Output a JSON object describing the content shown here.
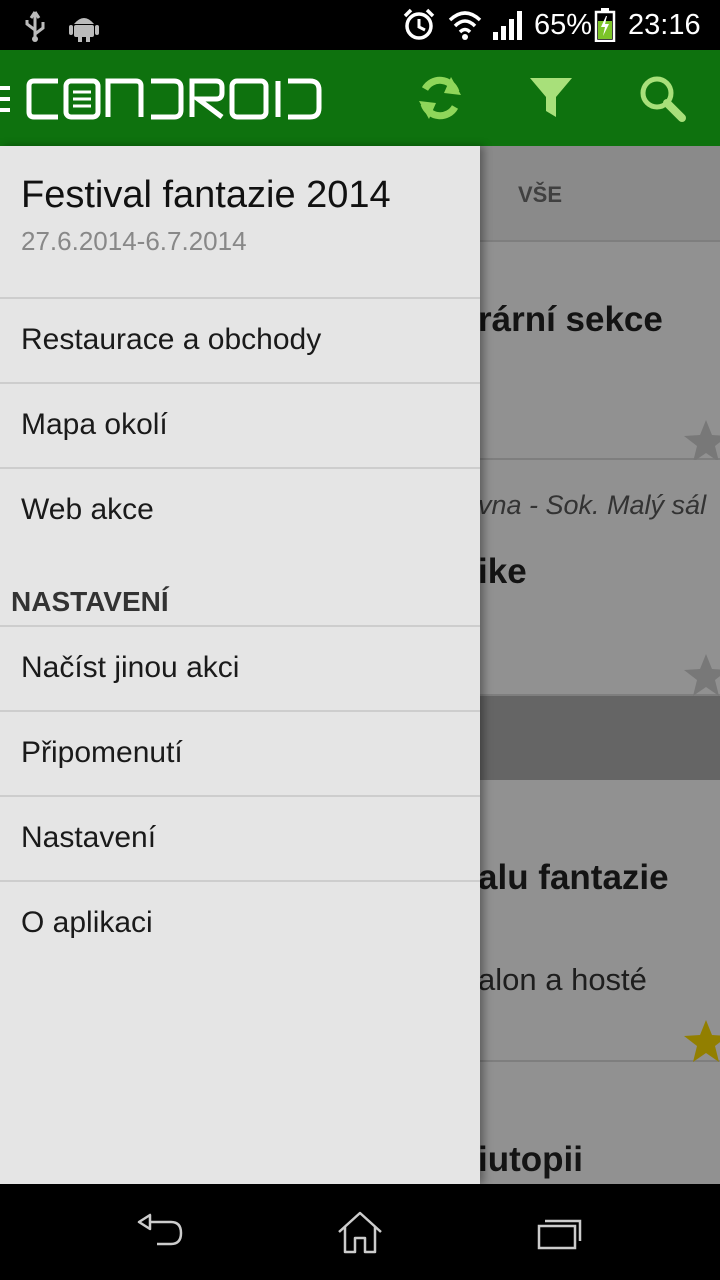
{
  "status_bar": {
    "battery_percent": "65%",
    "time": "23:16",
    "icons": [
      "usb-icon",
      "android-debug-icon",
      "alarm-icon",
      "wifi-icon",
      "signal-icon",
      "battery-charging-icon"
    ]
  },
  "app_bar": {
    "logo_text": "CONDROID",
    "actions": [
      "refresh",
      "filter",
      "search"
    ],
    "color": "#0e720e"
  },
  "background": {
    "tab_label": "VŠE",
    "cards": [
      {
        "title": "rární sekce"
      },
      {
        "subtitle": "vna - Sok. Malý sál",
        "title": "ike"
      },
      {
        "title": "alu fantazie",
        "text": "alon a hosté"
      },
      {
        "title": "iutopii"
      }
    ]
  },
  "drawer": {
    "event_title": "Festival fantazie 2014",
    "event_dates": "27.6.2014-6.7.2014",
    "items": [
      {
        "label": "Restaurace a obchody"
      },
      {
        "label": "Mapa okolí"
      },
      {
        "label": "Web akce"
      }
    ],
    "settings_header": "NASTAVENÍ",
    "settings_items": [
      {
        "label": "Načíst jinou akci"
      },
      {
        "label": "Připomenutí"
      },
      {
        "label": "Nastavení"
      },
      {
        "label": "O aplikaci"
      }
    ]
  },
  "nav_bar": {
    "buttons": [
      "back",
      "home",
      "recent-apps"
    ]
  }
}
